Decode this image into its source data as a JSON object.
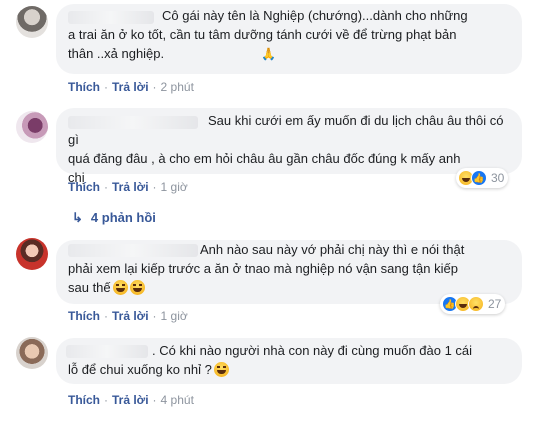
{
  "comments": [
    {
      "text": "Cô gái này tên là Nghiệp (chướng)...dành cho những\na trai ăn ở ko tốt, cần tu tâm dưỡng tánh cưới về để trừng phạt bản\nthân ..xả nghiệp.",
      "emoji": "pray-icon",
      "like": "Thích",
      "reply": "Trả lời",
      "time": "2 phút"
    },
    {
      "text": "Sau khi cưới em ấy muốn đi du lịch châu âu thôi có gì\nquá đăng đâu , à cho em hỏi châu âu gần châu đốc đúng k mấy anh\nchị",
      "like": "Thích",
      "reply": "Trả lời",
      "time": "1 giờ",
      "reaction_count": "30",
      "reactions": [
        "haha-icon",
        "like-icon"
      ]
    },
    {
      "text": "Anh nào sau này vớ phải chị này thì e nói thật\nphải xem lại kiếp trước a ăn ở tnao mà nghiệp nó vận sang tận kiếp\nsau thế",
      "emoji": "laugh-icon",
      "like": "Thích",
      "reply": "Trả lời",
      "time": "1 giờ",
      "reaction_count": "27",
      "reactions": [
        "like-icon",
        "haha-icon",
        "sad-icon"
      ]
    },
    {
      "text": ". Có khi nào người nhà con này đi cùng muốn đào 1 cái\nlỗ để chui xuống ko nhỉ ?",
      "emoji": "laugh-icon",
      "like": "Thích",
      "reply": "Trả lời",
      "time": "4 phút"
    }
  ],
  "replies_link": "4 phản hồi",
  "colors": {
    "link": "#385898",
    "bubble": "#f2f3f5",
    "meta": "#8d949e"
  }
}
